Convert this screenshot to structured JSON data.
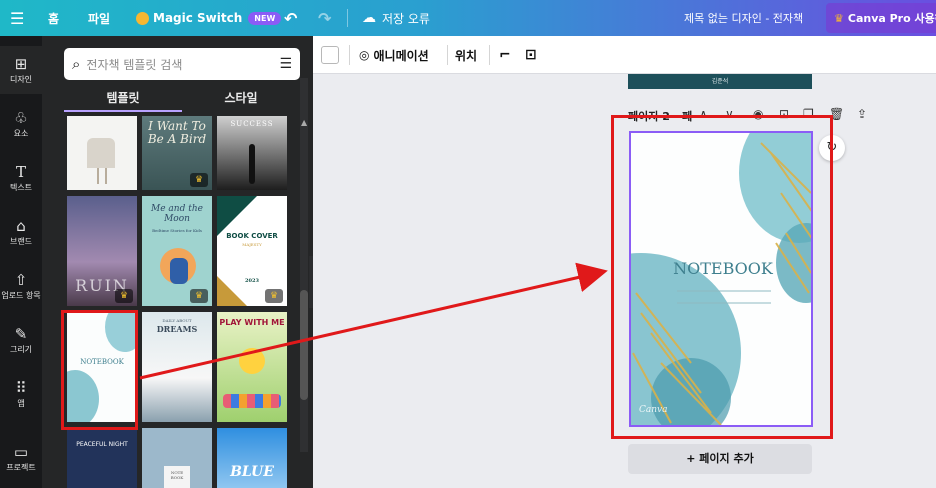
{
  "topbar": {
    "menu_icon": "hamburger-icon",
    "home": "홈",
    "file": "파일",
    "magic_switch": "Magic Switch",
    "magic_badge": "NEW",
    "save_status": "저장 오류",
    "doc_title": "제목 없는 디자인 - 전자책",
    "pro_button": "Canva Pro 사용해"
  },
  "rail": {
    "items": [
      {
        "label": "디자인",
        "icon": "layout-icon"
      },
      {
        "label": "요소",
        "icon": "shapes-icon"
      },
      {
        "label": "텍스트",
        "icon": "text-icon"
      },
      {
        "label": "브랜드",
        "icon": "brand-icon"
      },
      {
        "label": "업로드 항목",
        "icon": "upload-icon"
      },
      {
        "label": "그리기",
        "icon": "draw-icon"
      },
      {
        "label": "앱",
        "icon": "apps-icon"
      },
      {
        "label": "프로젝트",
        "icon": "folder-icon"
      }
    ]
  },
  "panel": {
    "search_placeholder": "전자책 템플릿 검색",
    "tabs": [
      "템플릿",
      "스타일"
    ],
    "templates": [
      {
        "title": "",
        "subtitle": "",
        "pro": false
      },
      {
        "title": "I Want To Be A Bird",
        "subtitle": "",
        "pro": true
      },
      {
        "title": "SUCCESS",
        "subtitle": "",
        "pro": false
      },
      {
        "title": "RUIN",
        "subtitle": "",
        "pro": true
      },
      {
        "title": "Me and the Moon",
        "subtitle": "Bedtime Stories for Kids",
        "pro": true
      },
      {
        "title": "BOOK COVER",
        "subtitle": "MAJESTY",
        "year": "2023",
        "pro": true
      },
      {
        "title": "NOTEBOOK",
        "subtitle": "",
        "pro": false
      },
      {
        "title": "DREAMS",
        "subtitle": "DAILY ABOUT",
        "pro": false
      },
      {
        "title": "PLAY WITH ME",
        "subtitle": "",
        "pro": false
      },
      {
        "title": "PEACEFUL NIGHT",
        "subtitle": "",
        "pro": false
      },
      {
        "title": "NOTE BOOK",
        "subtitle": "",
        "pro": false
      },
      {
        "title": "BLUE",
        "subtitle": "",
        "pro": false
      }
    ]
  },
  "toolbar": {
    "animate": "애니메이션",
    "position": "위치"
  },
  "canvas": {
    "prev_page_author": "김준석",
    "page_label": "페이지 2 - 페",
    "page_title": "NOTEBOOK",
    "page_signature": "Canva",
    "add_page": "+ 페이지 추가"
  },
  "annotation": {
    "color": "#e0191a"
  }
}
